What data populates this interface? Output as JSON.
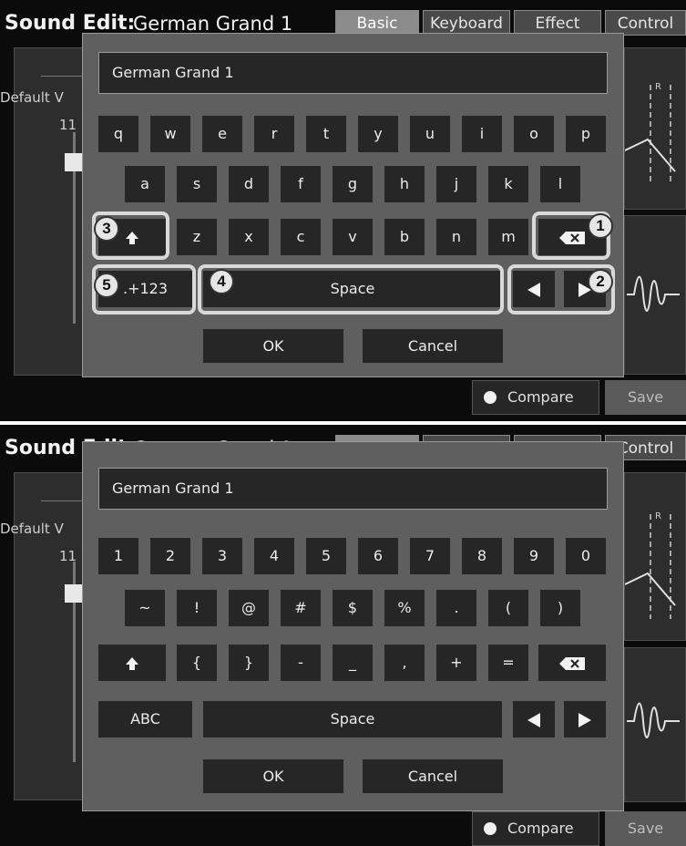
{
  "header": {
    "title_bold": "Sound Edit:",
    "title_name": "German Grand 1",
    "tabs": [
      "Basic",
      "Keyboard",
      "Effect",
      "Control"
    ]
  },
  "background": {
    "default_label": "Default V",
    "value_partial": "11",
    "compare_label": "Compare",
    "save_label": "Save"
  },
  "dialog": {
    "text_value": "German Grand 1",
    "ok_label": "OK",
    "cancel_label": "Cancel",
    "space_label": "Space"
  },
  "keyboard_letters": {
    "row1": [
      "q",
      "w",
      "e",
      "r",
      "t",
      "y",
      "u",
      "i",
      "o",
      "p"
    ],
    "row2": [
      "a",
      "s",
      "d",
      "f",
      "g",
      "h",
      "j",
      "k",
      "l"
    ],
    "row3": [
      "z",
      "x",
      "c",
      "v",
      "b",
      "n",
      "m"
    ],
    "mode_label": ".+123"
  },
  "keyboard_symbols": {
    "row1": [
      "1",
      "2",
      "3",
      "4",
      "5",
      "6",
      "7",
      "8",
      "9",
      "0"
    ],
    "row2": [
      "~",
      "!",
      "@",
      "#",
      "$",
      "%",
      ".",
      "(",
      ")"
    ],
    "row3": [
      "{",
      "}",
      "-",
      "_",
      ",",
      "+",
      "="
    ],
    "mode_label": "ABC"
  },
  "callouts": [
    "1",
    "2",
    "3",
    "4",
    "5"
  ],
  "icons": {
    "shift": "shift-up-arrow-icon",
    "backspace": "backspace-icon",
    "left": "left-triangle-icon",
    "right": "right-triangle-icon",
    "compare": "compare-dot-icon",
    "waveform": "waveform-icon",
    "envelope": "envelope-graph-icon"
  },
  "colors": {
    "background": "#0b0b0b",
    "dialog": "#5f5f5f",
    "key": "#262626",
    "highlight": "#d9d9d9"
  }
}
